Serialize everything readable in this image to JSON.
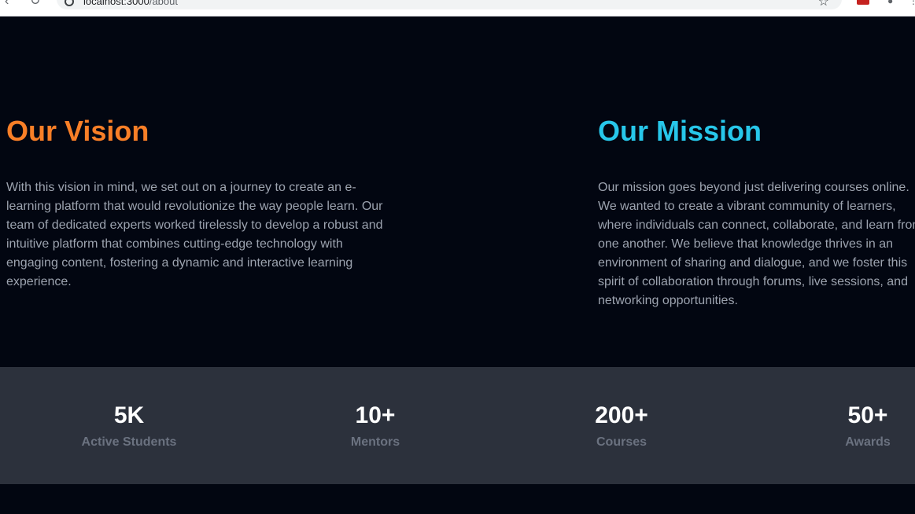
{
  "browser": {
    "url_host": "localhost:3000",
    "url_path": "/about"
  },
  "vision": {
    "title": "Our Vision",
    "text": "With this vision in mind, we set out on a journey to create an e-learning platform that would revolutionize the way people learn. Our team of dedicated experts worked tirelessly to develop a robust and intuitive platform that combines cutting-edge technology with engaging content, fostering a dynamic and interactive learning experience."
  },
  "mission": {
    "title": "Our Mission",
    "text": "Our mission goes beyond just delivering courses online. We wanted to create a vibrant community of learners, where individuals can connect, collaborate, and learn from one another. We believe that knowledge thrives in an environment of sharing and dialogue, and we foster this spirit of collaboration through forums, live sessions, and networking opportunities."
  },
  "stats": [
    {
      "value": "5K",
      "label": "Active Students"
    },
    {
      "value": "10+",
      "label": "Mentors"
    },
    {
      "value": "200+",
      "label": "Courses"
    },
    {
      "value": "50+",
      "label": "Awards"
    }
  ],
  "colors": {
    "vision_accent": "#f97f27",
    "mission_accent": "#27c7ea",
    "page_bg": "#020611",
    "stats_bg": "#2c313c"
  }
}
